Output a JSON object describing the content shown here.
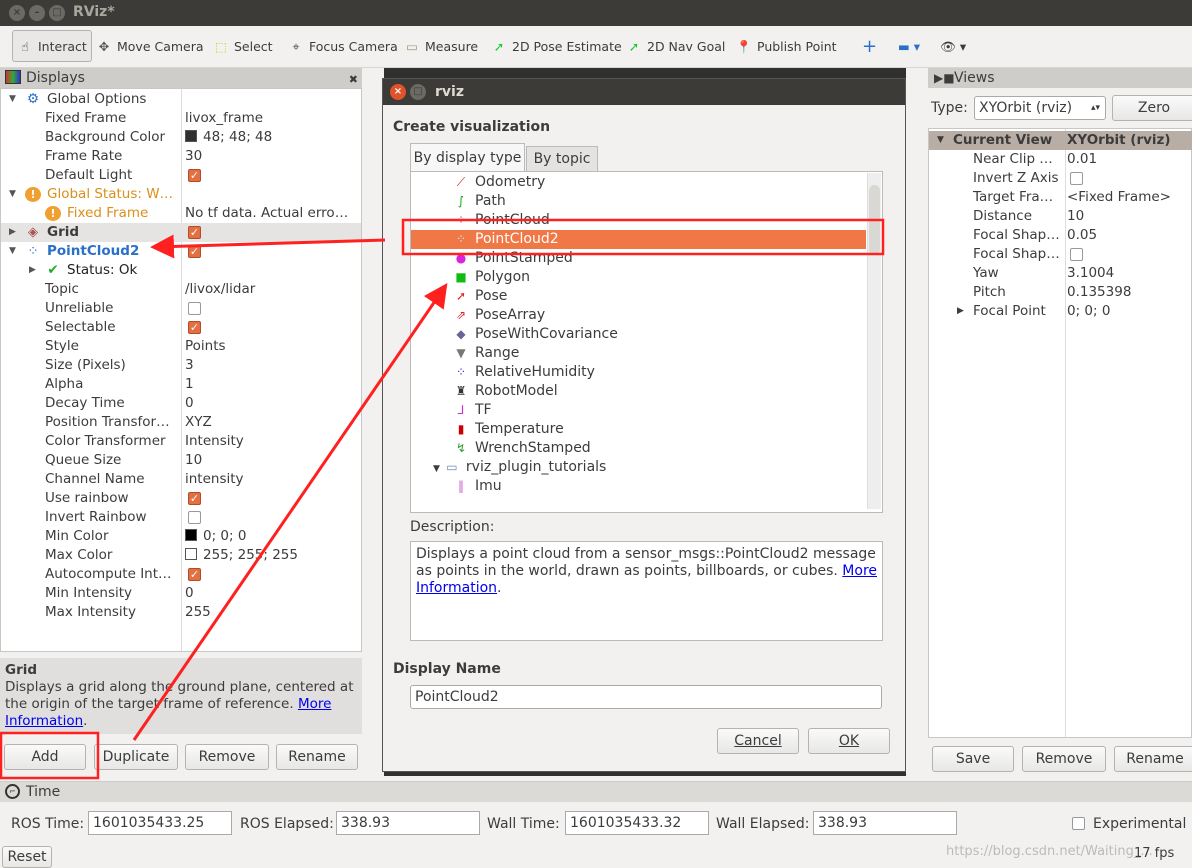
{
  "window": {
    "title": "RViz*"
  },
  "toolbar": {
    "tools": [
      {
        "label": "Interact",
        "icon": "hand-icon"
      },
      {
        "label": "Move Camera",
        "icon": "move-icon"
      },
      {
        "label": "Select",
        "icon": "select-icon"
      },
      {
        "label": "Focus Camera",
        "icon": "focus-icon"
      },
      {
        "label": "Measure",
        "icon": "ruler-icon"
      },
      {
        "label": "2D Pose Estimate",
        "icon": "green-arrow-icon"
      },
      {
        "label": "2D Nav Goal",
        "icon": "green-arrow-icon"
      },
      {
        "label": "Publish Point",
        "icon": "pin-icon"
      }
    ]
  },
  "displays": {
    "title": "Displays",
    "rows": [
      {
        "name": "Global Options",
        "value": "",
        "indent": 1,
        "kind": "gear",
        "exp": "▼"
      },
      {
        "name": "Fixed Frame",
        "value": "livox_frame",
        "indent": 2
      },
      {
        "name": "Background Color",
        "value": "48; 48; 48",
        "indent": 2,
        "swatch": "#303030"
      },
      {
        "name": "Frame Rate",
        "value": "30",
        "indent": 2
      },
      {
        "name": "Default Light",
        "value": "",
        "indent": 2,
        "check": true
      },
      {
        "name": "Global Status: W…",
        "value": "",
        "indent": 1,
        "kind": "warn",
        "exp": "▼"
      },
      {
        "name": "Fixed Frame",
        "value": "No tf data.  Actual erro…",
        "indent": 2,
        "kind": "warn"
      },
      {
        "name": "Grid",
        "value": "",
        "indent": 1,
        "kind": "grid",
        "exp": "▶",
        "check": true,
        "bold": true,
        "hl": true
      },
      {
        "name": "PointCloud2",
        "value": "",
        "indent": 1,
        "kind": "pc",
        "exp": "▼",
        "check": true,
        "bold": true,
        "blue": true
      },
      {
        "name": "Status: Ok",
        "value": "",
        "indent": 2,
        "kind": "ok",
        "exp": "▶"
      },
      {
        "name": "Topic",
        "value": "/livox/lidar",
        "indent": 2
      },
      {
        "name": "Unreliable",
        "value": "",
        "indent": 2,
        "check": false
      },
      {
        "name": "Selectable",
        "value": "",
        "indent": 2,
        "check": true
      },
      {
        "name": "Style",
        "value": "Points",
        "indent": 2
      },
      {
        "name": "Size (Pixels)",
        "value": "3",
        "indent": 2
      },
      {
        "name": "Alpha",
        "value": "1",
        "indent": 2
      },
      {
        "name": "Decay Time",
        "value": "0",
        "indent": 2
      },
      {
        "name": "Position Transfor…",
        "value": "XYZ",
        "indent": 2
      },
      {
        "name": "Color Transformer",
        "value": "Intensity",
        "indent": 2
      },
      {
        "name": "Queue Size",
        "value": "10",
        "indent": 2
      },
      {
        "name": "Channel Name",
        "value": "intensity",
        "indent": 2
      },
      {
        "name": "Use rainbow",
        "value": "",
        "indent": 2,
        "check": true
      },
      {
        "name": "Invert Rainbow",
        "value": "",
        "indent": 2,
        "check": false
      },
      {
        "name": "Min Color",
        "value": "0; 0; 0",
        "indent": 2,
        "swatch": "#000000"
      },
      {
        "name": "Max Color",
        "value": "255; 255; 255",
        "indent": 2,
        "swatch": "#ffffff"
      },
      {
        "name": "Autocompute Int…",
        "value": "",
        "indent": 2,
        "check": true
      },
      {
        "name": "Min Intensity",
        "value": "0",
        "indent": 2
      },
      {
        "name": "Max Intensity",
        "value": "255",
        "indent": 2
      }
    ],
    "desc_title": "Grid",
    "desc_text": "Displays a grid along the ground plane, centered at the origin of the target frame of reference. ",
    "desc_link": "More Information",
    "buttons": {
      "add": "Add",
      "duplicate": "Duplicate",
      "remove": "Remove",
      "rename": "Rename"
    }
  },
  "dialog": {
    "title": "rviz",
    "heading": "Create visualization",
    "tabs": [
      "By display type",
      "By topic"
    ],
    "items": [
      {
        "label": "Odometry",
        "icon": "odometry-icon",
        "g": "⟋",
        "c": "#d22"
      },
      {
        "label": "Path",
        "icon": "path-icon",
        "g": "∫",
        "c": "#1a1"
      },
      {
        "label": "PointCloud",
        "icon": "pointcloud-icon",
        "g": "⁘",
        "c": "#c33"
      },
      {
        "label": "PointCloud2",
        "icon": "pointcloud2-icon",
        "g": "⁘",
        "c": "#36c",
        "selected": true
      },
      {
        "label": "PointStamped",
        "icon": "point-icon",
        "g": "●",
        "c": "#d2d"
      },
      {
        "label": "Polygon",
        "icon": "polygon-icon",
        "g": "■",
        "c": "#1b1"
      },
      {
        "label": "Pose",
        "icon": "pose-icon",
        "g": "➚",
        "c": "#d22"
      },
      {
        "label": "PoseArray",
        "icon": "posearray-icon",
        "g": "⇗",
        "c": "#d22"
      },
      {
        "label": "PoseWithCovariance",
        "icon": "covariance-icon",
        "g": "◆",
        "c": "#669"
      },
      {
        "label": "Range",
        "icon": "range-icon",
        "g": "▼",
        "c": "#777"
      },
      {
        "label": "RelativeHumidity",
        "icon": "humidity-icon",
        "g": "⁘",
        "c": "#33c"
      },
      {
        "label": "RobotModel",
        "icon": "robot-icon",
        "g": "♜",
        "c": "#333"
      },
      {
        "label": "TF",
        "icon": "tf-icon",
        "g": "⅃",
        "c": "#c3c"
      },
      {
        "label": "Temperature",
        "icon": "temperature-icon",
        "g": "▮",
        "c": "#c00"
      },
      {
        "label": "WrenchStamped",
        "icon": "wrench-icon",
        "g": "↯",
        "c": "#393"
      },
      {
        "label": "rviz_plugin_tutorials",
        "icon": "folder-icon",
        "g": "▭",
        "c": "#6a8bb5",
        "folder": true
      },
      {
        "label": "Imu",
        "icon": "imu-icon",
        "g": "‖",
        "c": "#c6c"
      }
    ],
    "desc_label": "Description:",
    "desc_text": "Displays a point cloud from a sensor_msgs::PointCloud2 message as points in the world, drawn as points, billboards, or cubes. ",
    "desc_link": "More Information",
    "desc_end": ".",
    "name_label": "Display Name",
    "name_value": "PointCloud2",
    "cancel": "Cancel",
    "ok": "OK"
  },
  "views": {
    "title": "Views",
    "type_label": "Type:",
    "type_value": "XYOrbit (rviz)",
    "zero": "Zero",
    "head_name": "Current View",
    "head_value": "XYOrbit (rviz)",
    "rows": [
      {
        "name": "Near Clip …",
        "value": "0.01"
      },
      {
        "name": "Invert Z Axis",
        "value": "",
        "check": false
      },
      {
        "name": "Target Fra…",
        "value": "<Fixed Frame>"
      },
      {
        "name": "Distance",
        "value": "10"
      },
      {
        "name": "Focal Shap…",
        "value": "0.05"
      },
      {
        "name": "Focal Shap…",
        "value": "",
        "check": false
      },
      {
        "name": "Yaw",
        "value": "3.1004"
      },
      {
        "name": "Pitch",
        "value": "0.135398"
      },
      {
        "name": "Focal Point",
        "value": "0; 0; 0",
        "exp": "▶"
      }
    ],
    "buttons": {
      "save": "Save",
      "remove": "Remove",
      "rename": "Rename"
    }
  },
  "time": {
    "title": "Time",
    "ros_time_label": "ROS Time:",
    "ros_time": "1601035433.25",
    "ros_elapsed_label": "ROS Elapsed:",
    "ros_elapsed": "338.93",
    "wall_time_label": "Wall Time:",
    "wall_time": "1601035433.32",
    "wall_elapsed_label": "Wall Elapsed:",
    "wall_elapsed": "338.93",
    "experimental": "Experimental"
  },
  "status": {
    "reset": "Reset",
    "fps": "17 fps",
    "watermark": "https://blog.csdn.net/Waiting_..."
  },
  "colors": {
    "selection": "#f07746",
    "annotation": "#ff2020",
    "titlebar": "#3c3b37"
  }
}
